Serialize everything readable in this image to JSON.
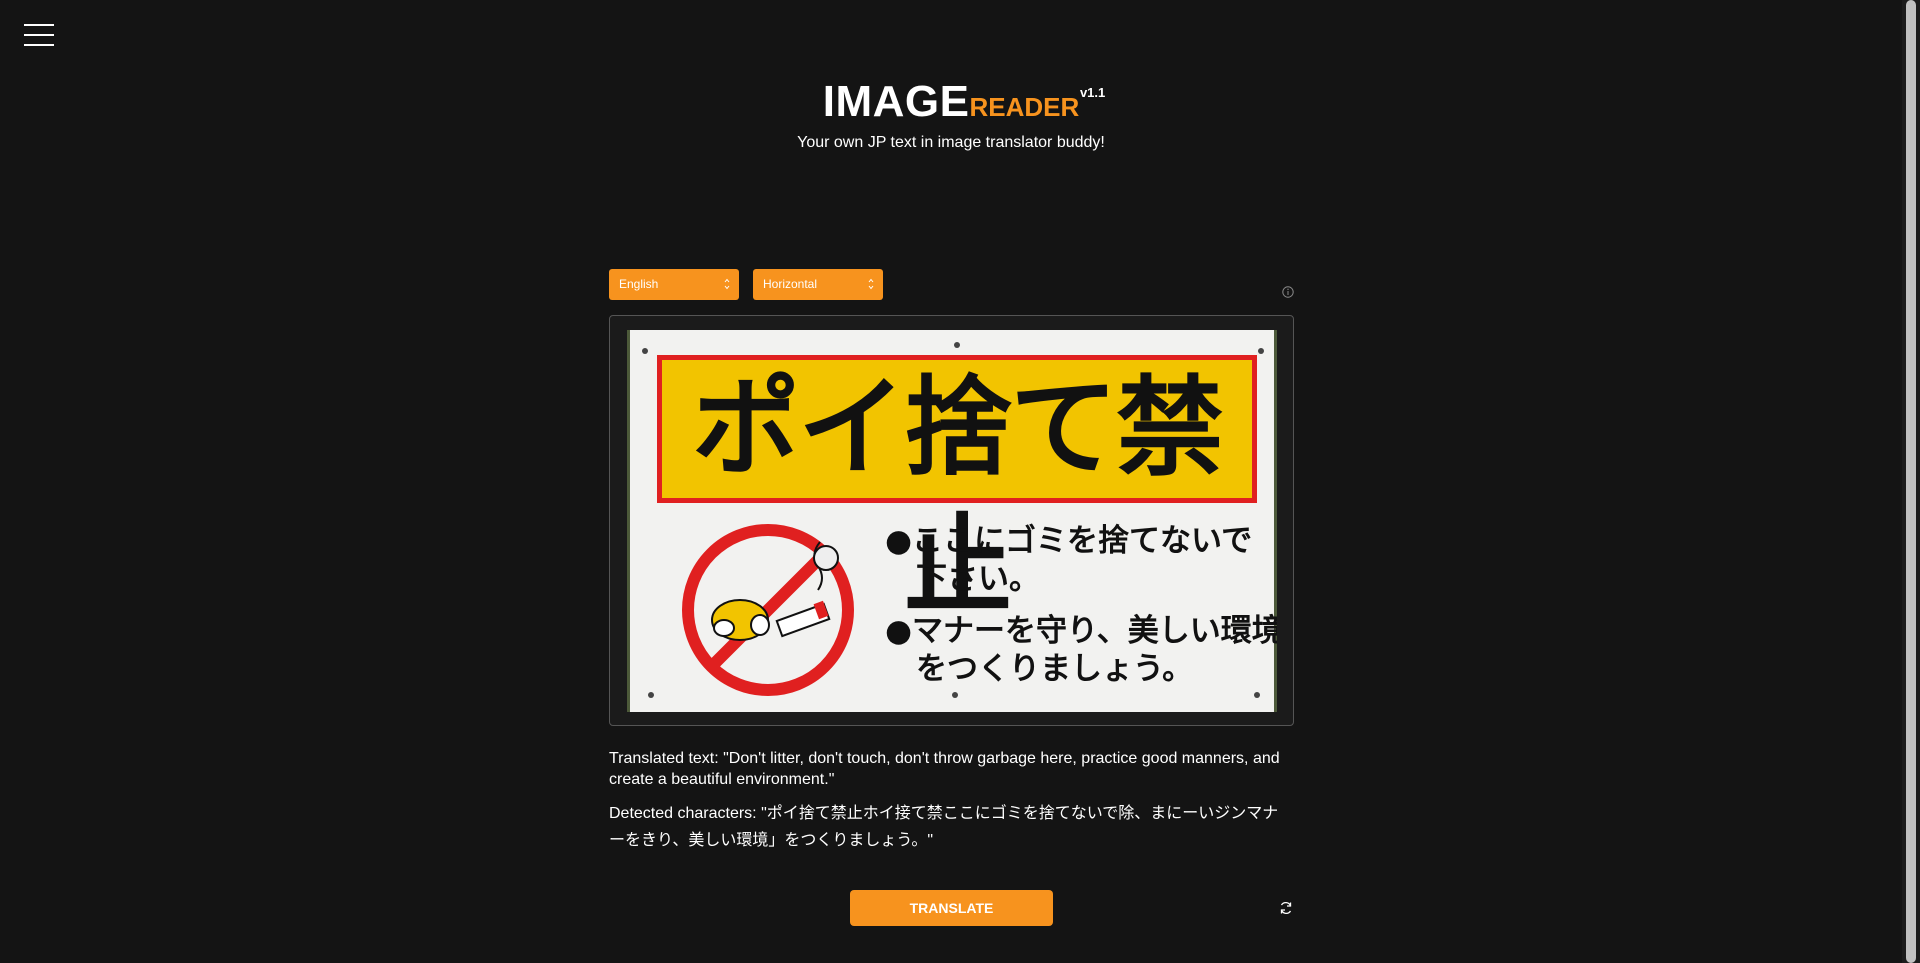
{
  "app": {
    "logo_main": "IMAGE",
    "logo_accent": "READER",
    "version": "v1.1",
    "subtitle": "Your own JP text in image translator buddy!"
  },
  "controls": {
    "language_selected": "English",
    "orientation_selected": "Horizontal"
  },
  "sign": {
    "headline": "ポイ捨て禁止",
    "line1a": "●ここにゴミを捨てないで",
    "line1b": "下さい。",
    "line2a": "●マナーを守り、美しい環境",
    "line2b": "をつくりましょう。"
  },
  "result": {
    "translated": "Translated text: \"Don't litter, don't touch, don't throw garbage here, practice good manners, and create a beautiful environment.\"",
    "detected": "Detected characters: \"ポイ捨て禁止ホイ接て禁ここにゴミを捨てないで除、まにーいジンマナーをきり、美しい環境」をつくりましょう。\""
  },
  "actions": {
    "translate_label": "TRANSLATE"
  },
  "colors": {
    "accent": "#f7931e",
    "background": "#141414"
  }
}
